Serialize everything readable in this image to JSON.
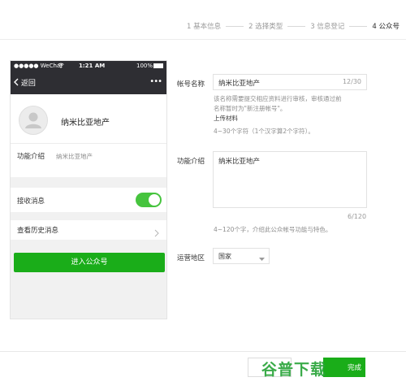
{
  "steps": [
    {
      "label": "1 基本信息"
    },
    {
      "label": "2 选择类型"
    },
    {
      "label": "3 信息登记"
    },
    {
      "label": "4 公众号"
    }
  ],
  "phone": {
    "carrier": "●●●●● WeChat",
    "time": "1:21 AM",
    "battery": "100%",
    "back_label": "返回",
    "more": "•••",
    "account_name": "纳米比亚地产",
    "intro_label": "功能介绍",
    "intro_value": "纳米比亚地产",
    "receive_label": "接收消息",
    "receive_on": true,
    "history_label": "查看历史消息",
    "enter_button": "进入公众号"
  },
  "form": {
    "name_label": "帐号名称",
    "name_value": "纳米比亚地产",
    "name_count": "12/30",
    "name_hint1": "该名称需要提交相应资料进行审核，审核通过前",
    "name_hint2": "名称暂时为\"新注册帐号\"。",
    "upload_label": "上传材料",
    "name_rule": "4~30个字符（1个汉字算2个字符）。",
    "intro_label": "功能介绍",
    "intro_value": "纳米比亚地产",
    "intro_count": "6/120",
    "intro_rule": "4~120个字，介绍此公众帐号功能与特色。",
    "region_label": "运营地区",
    "region_value": "国家"
  },
  "footer": {
    "complete_label": "完成",
    "watermark": "谷普下载"
  },
  "colors": {
    "accent": "#1aad19",
    "toggle": "#46c43e"
  }
}
